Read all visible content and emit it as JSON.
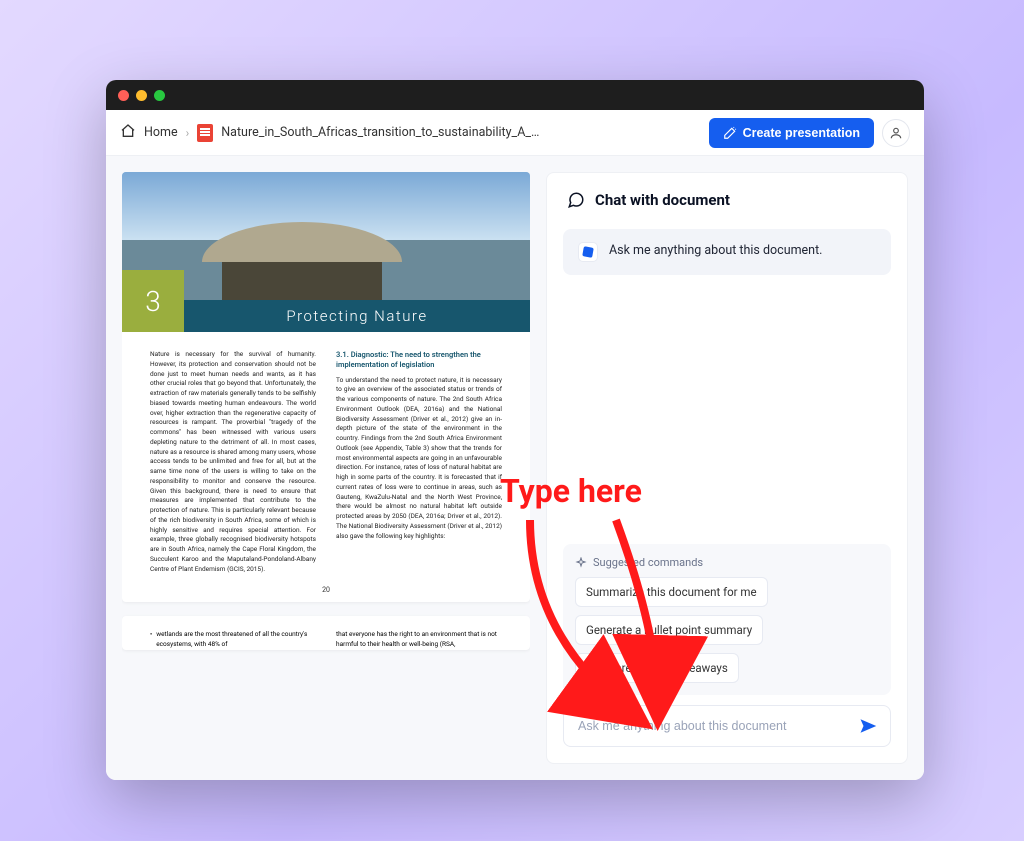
{
  "breadcrumbs": {
    "home": "Home",
    "file": "Nature_in_South_Africas_transition_to_sustainability_A_sto..."
  },
  "actions": {
    "create_label": "Create presentation"
  },
  "doc": {
    "chapter_number": "3",
    "banner_title": "Protecting Nature",
    "page_number": "20",
    "col1": "Nature is necessary for the survival of humanity. However, its protection and conservation should not be done just to meet human needs and wants, as it has other crucial roles that go beyond that. Unfortunately, the extraction of raw materials generally tends to be selfishly biased towards meeting human endeavours. The world over, higher extraction than the regenerative capacity of resources is rampant. The proverbial \"tragedy of the commons\" has been witnessed with various users depleting nature to the detriment of all. In most cases, nature as a resource is shared among many users, whose access tends to be unlimited and free for all, but at the same time none of the users is willing to take on the responsibility to monitor and conserve the resource. Given this background, there is need to ensure that measures are implemented that contribute to the protection of nature. This is particularly relevant because of the rich biodiversity in South Africa, some of which is highly sensitive and requires special attention. For example, three globally recognised biodiversity hotspots are in South Africa, namely the Cape Floral Kingdom, the Succulent Karoo and the Maputaland-Pondoland-Albany Centre of Plant Endemism (GCIS, 2015).",
    "section_heading": "3.1. Diagnostic: The need to strengthen the implementation of legislation",
    "col2": "To understand the need to protect nature, it is necessary to give an overview of the associated status or trends of the various components of nature. The 2nd South Africa Environment Outlook (DEA, 2016a) and the National Biodiversity Assessment (Driver et al., 2012) give an in-depth picture of the state of the environment in the country. Findings from the 2nd South Africa Environment Outlook (see Appendix, Table 3) show that the trends for most environmental aspects are going in an unfavourable direction. For instance, rates of loss of natural habitat are high in some parts of the country. It is forecasted that if current rates of loss were to continue in areas, such as Gauteng, KwaZulu-Natal and the North West Province, there would be almost no natural habitat left outside protected areas by 2050 (DEA, 2016a; Driver et al., 2012). The National Biodiversity Assessment (Driver et al., 2012) also gave the following key highlights:",
    "page2_left": "wetlands are the most threatened of all the country's ecosystems, with 48% of",
    "page2_right": "that everyone has the right to an environment that is not harmful to their health or well-being (RSA,"
  },
  "chat": {
    "header": "Chat with document",
    "welcome": "Ask me anything about this document.",
    "suggested_label": "Suggested commands",
    "suggestions": [
      "Summarize this document for me",
      "Generate a bullet point summary",
      "What are the key takeaways"
    ],
    "placeholder": "Ask me anything about this document"
  },
  "annotation": {
    "label": "Type here"
  }
}
